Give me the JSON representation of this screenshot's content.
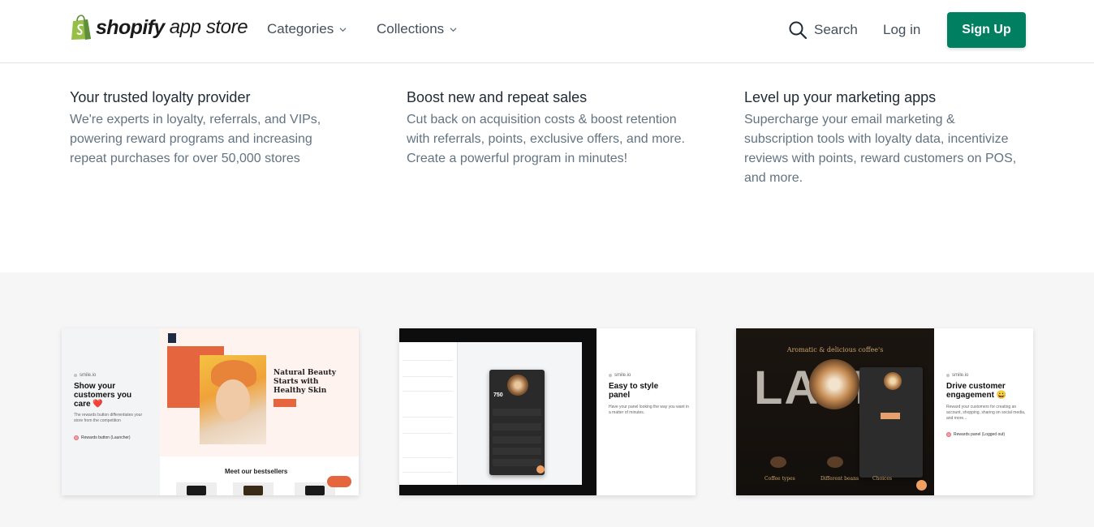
{
  "header": {
    "logo_word": "shopify",
    "logo_sub": "app store",
    "nav": [
      {
        "label": "Categories"
      },
      {
        "label": "Collections"
      }
    ],
    "search_label": "Search",
    "login_label": "Log in",
    "signup_label": "Sign Up",
    "signup_color": "#008060"
  },
  "features": [
    {
      "title": "Your trusted loyalty provider",
      "text": "We're experts in loyalty, referrals, and VIPs, powering reward programs and increasing repeat purchases for over 50,000 stores"
    },
    {
      "title": "Boost new and repeat sales",
      "text": "Cut back on acquisition costs & boost retention with referrals, points, exclusive offers, and more. Create a powerful program in minutes!"
    },
    {
      "title": "Level up your marketing apps",
      "text": "Supercharge your email marketing & subscription tools with loyalty data, incentivize reviews with points, reward customers on POS, and more."
    }
  ],
  "cards": [
    {
      "brand": "smile.io",
      "title": "Show your customers you care ❤️",
      "desc": "The rewards button differentiates your store from the competition",
      "pill": "Rewards button (Launcher)",
      "hero_headline": "Natural Beauty Starts with Healthy Skin",
      "bottom_title": "Meet our bestsellers"
    },
    {
      "brand": "smile.io",
      "title": "Easy to style panel",
      "desc": "Have your panel looking the way you want in a matter of minutes.",
      "points": "750"
    },
    {
      "brand": "smile.io",
      "title": "Drive customer engagement 😀",
      "desc": "Reward your customers for creating an account, shopping, sharing on social media, and more...",
      "pill": "Rewards panel (Logged out)",
      "hero_title": "Aromatic & delicious coffee's",
      "hero_word": "LATTE",
      "captions": [
        "Coffee types",
        "Different beans",
        "Choices"
      ]
    }
  ]
}
